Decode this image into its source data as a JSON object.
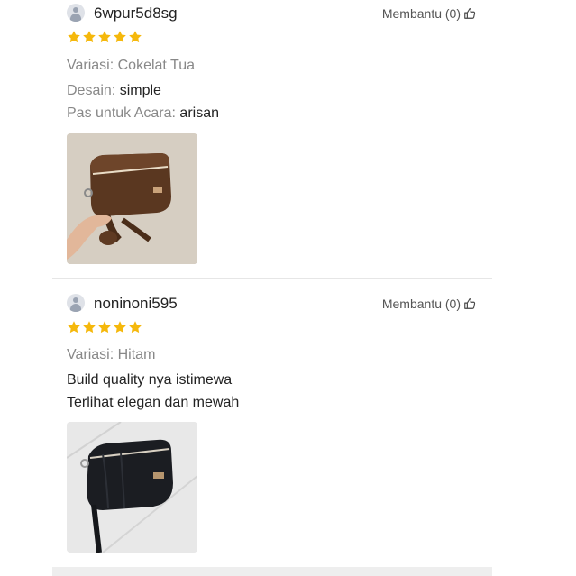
{
  "colors": {
    "star": "#f5b80c",
    "muted": "#888888",
    "text": "#222222"
  },
  "reviews": [
    {
      "username": "6wpur5d8sg",
      "helpful": "Membantu (0)",
      "rating": 5,
      "variation_label": "Variasi:",
      "variation_value": "Cokelat Tua",
      "design_label": "Desain:",
      "design_value": "simple",
      "occasion_label": "Pas untuk Acara:",
      "occasion_value": "arisan",
      "photo_icon": "brown-clutch-bag-photo"
    },
    {
      "username": "noninoni595",
      "helpful": "Membantu (0)",
      "rating": 5,
      "variation_label": "Variasi:",
      "variation_value": "Hitam",
      "comment": [
        "Build quality nya istimewa",
        "Terlihat elegan dan mewah"
      ],
      "photo_icon": "black-clutch-bag-photo"
    }
  ]
}
